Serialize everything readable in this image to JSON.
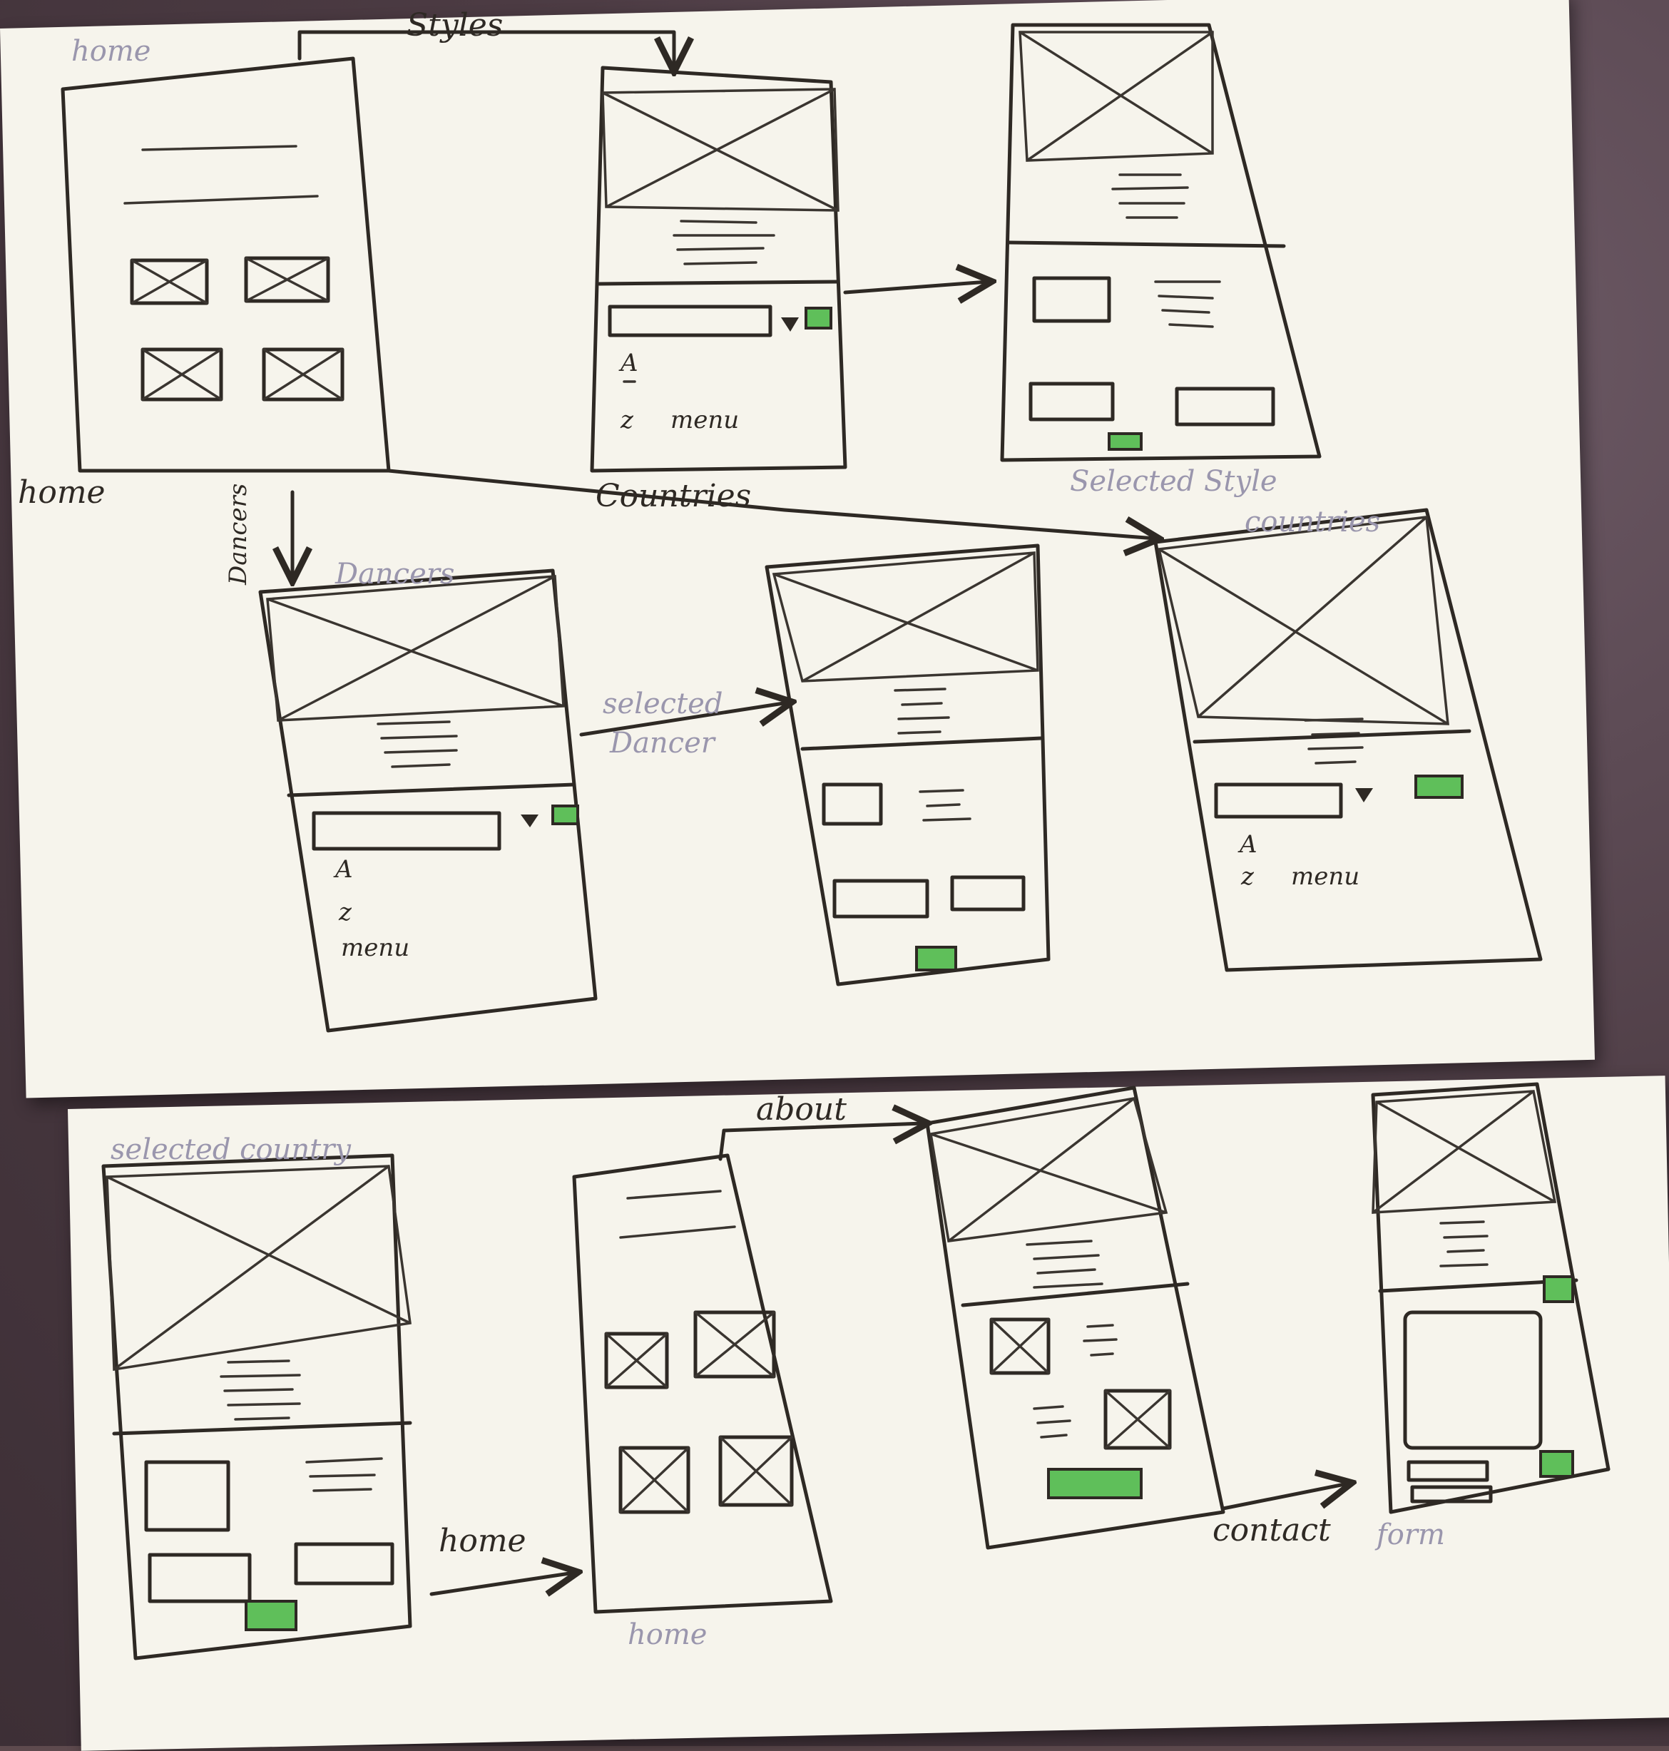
{
  "labels": {
    "home_top": "home",
    "home_left": "home",
    "styles": "Styles",
    "countries": "Countries",
    "selected_style": "Selected Style",
    "dancers_arrow": "Dancers",
    "dancers": "Dancers",
    "selected_dancer_1": "selected",
    "selected_dancer_2": "Dancer",
    "countries_small": "countries",
    "selected_country": "selected country",
    "home_arrow": "home",
    "home_under": "home",
    "about": "about",
    "contact": "contact",
    "form": "form",
    "menu": "menu",
    "az_a": "A",
    "az_z": "z"
  },
  "colors": {
    "ink": "#2e2924",
    "pencil": "#9a96ad",
    "highlight_green": "#5fbf5a",
    "paper": "#f6f4ec"
  }
}
